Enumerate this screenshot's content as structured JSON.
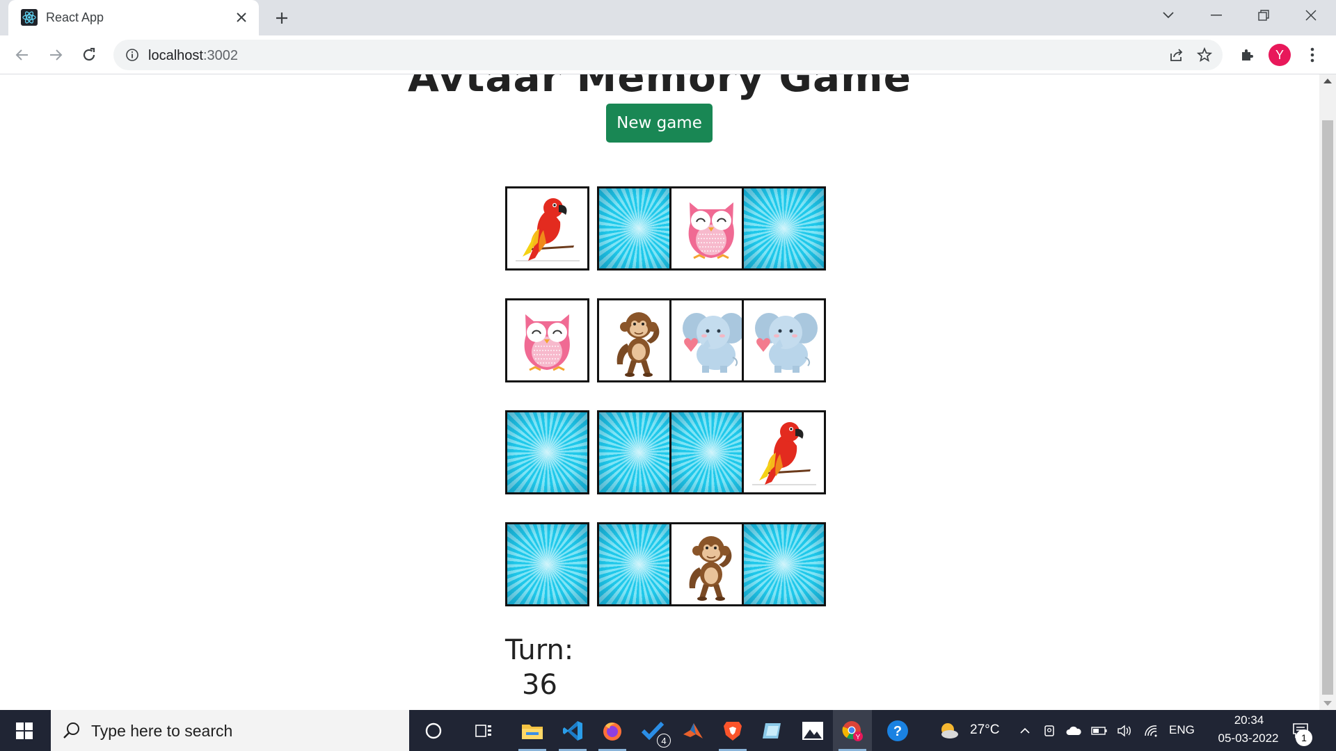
{
  "browser": {
    "tab_title": "React App",
    "url_host": "localhost",
    "url_port": ":3002"
  },
  "page": {
    "title": "Avtaar Memory Game",
    "new_game_label": "New game",
    "turn_label": "Turn:",
    "turn_value": "36"
  },
  "cards": [
    [
      "parrot",
      "back",
      "owl",
      "back"
    ],
    [
      "owl",
      "monkey",
      "elephant",
      "elephant"
    ],
    [
      "back",
      "back",
      "back",
      "parrot"
    ],
    [
      "back",
      "back",
      "monkey",
      "back"
    ]
  ],
  "taskbar": {
    "search_placeholder": "Type here to search",
    "weather_temp": "27°C",
    "language": "ENG",
    "time": "20:34",
    "date": "05-03-2022",
    "notification_count": "1",
    "vscode_badge": "4"
  },
  "colors": {
    "accent_button": "#198754",
    "card_back": "#1fc8ea",
    "taskbar": "#202534",
    "avatar": "#e8185a"
  }
}
